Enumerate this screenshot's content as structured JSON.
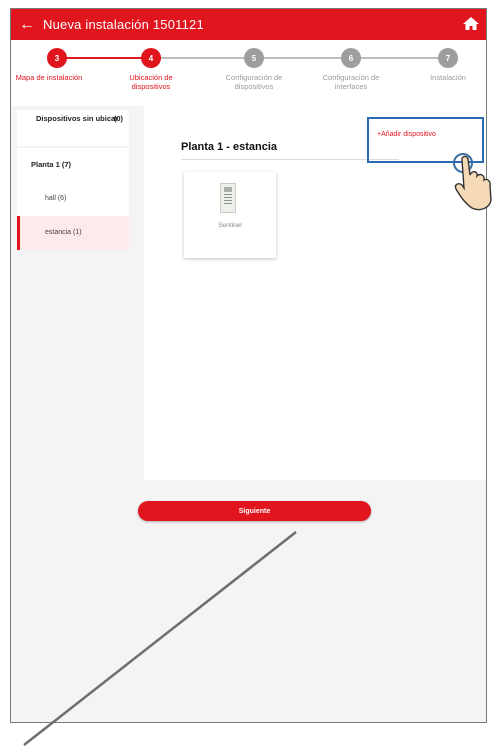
{
  "appbar": {
    "title": "Nueva instalación 1501121",
    "back_icon": "arrow-left-icon",
    "home_icon": "home-icon"
  },
  "steps": [
    {
      "number": "3",
      "label": "Mapa de instalación",
      "state": "active"
    },
    {
      "number": "4",
      "label": "Ubicación de dispositivos",
      "state": "active"
    },
    {
      "number": "5",
      "label": "Configuración de dispositivos",
      "state": "inactive"
    },
    {
      "number": "6",
      "label": "Configuración de interfaces",
      "state": "inactive"
    },
    {
      "number": "7",
      "label": "Instalación",
      "state": "inactive"
    }
  ],
  "sidebar": {
    "unplaced_label": "Dispositivos sin ubicar",
    "unplaced_count": "(0)",
    "floor_label": "Planta 1 (7)",
    "rooms": [
      {
        "label": "hall (6)",
        "selected": false
      },
      {
        "label": "estancia (1)",
        "selected": true
      }
    ]
  },
  "panel": {
    "title": "Planta 1 - estancia",
    "add_device_label": "+Añadir dispositivo",
    "devices": [
      {
        "label": "Sentinel"
      }
    ]
  },
  "footer": {
    "next_label": "Siguiente"
  },
  "colors": {
    "brand_red": "#e0151d",
    "highlight_blue": "#2a6bb8",
    "inactive_gray": "#9e9e9e"
  }
}
